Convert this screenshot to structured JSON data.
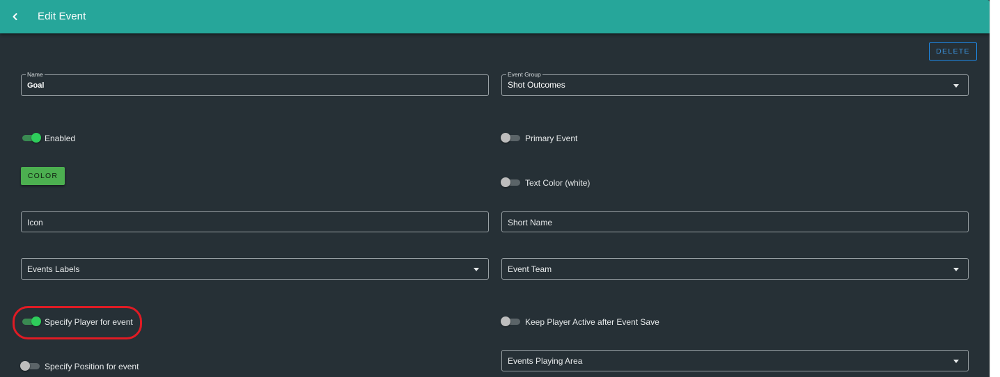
{
  "header": {
    "title": "Edit Event",
    "back_icon": "chevron-left-icon"
  },
  "actions": {
    "delete_label": "DELETE"
  },
  "form": {
    "name": {
      "label": "Name",
      "value": "Goal"
    },
    "event_group": {
      "label": "Event Group",
      "value": "Shot Outcomes"
    },
    "enabled": {
      "label": "Enabled",
      "on": true
    },
    "primary_event": {
      "label": "Primary Event",
      "on": false
    },
    "color_button": "COLOR",
    "text_color": {
      "label": "Text Color (white)",
      "on": false
    },
    "icon": {
      "placeholder": "Icon"
    },
    "short_name": {
      "placeholder": "Short Name"
    },
    "events_labels": {
      "placeholder": "Events Labels"
    },
    "event_team": {
      "placeholder": "Event Team"
    },
    "specify_player": {
      "label": "Specify Player for event",
      "on": true
    },
    "keep_player_active": {
      "label": "Keep Player Active after Event Save",
      "on": false
    },
    "specify_position": {
      "label": "Specify Position for event",
      "on": false
    },
    "events_playing_area": {
      "placeholder": "Events Playing Area"
    }
  },
  "colors": {
    "appbar": "#26a69a",
    "background": "#263036",
    "toggle_on": "#2ecc5b",
    "color_button": "#4caf50",
    "delete_outline": "#1e88e5",
    "highlight": "#e01b24"
  }
}
